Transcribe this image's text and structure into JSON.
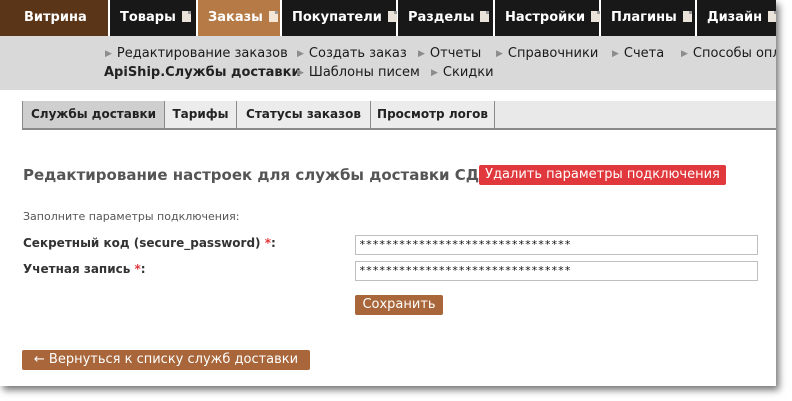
{
  "top_nav": [
    {
      "label": "Витрина"
    },
    {
      "label": "Товары"
    },
    {
      "label": "Заказы"
    },
    {
      "label": "Покупатели"
    },
    {
      "label": "Разделы"
    },
    {
      "label": "Настройки"
    },
    {
      "label": "Плагины"
    },
    {
      "label": "Дизайн"
    }
  ],
  "sub_nav": [
    {
      "label": "Редактирование заказов"
    },
    {
      "label": "Создать заказ"
    },
    {
      "label": "Отчеты"
    },
    {
      "label": "Справочники"
    },
    {
      "label": "Счета"
    },
    {
      "label": "Способы опл"
    },
    {
      "label": "ApiShip.Службы доставки"
    },
    {
      "label": "Шаблоны писем"
    },
    {
      "label": "Скидки"
    }
  ],
  "tabs": [
    {
      "label": "Службы доставки"
    },
    {
      "label": "Тарифы"
    },
    {
      "label": "Статусы заказов"
    },
    {
      "label": "Просмотр логов"
    }
  ],
  "page": {
    "heading": "Редактирование настроек для службы доставки СДЭК",
    "delete_button": "Удалить параметры подключения",
    "hint": "Заполните параметры подключения:",
    "fields": [
      {
        "label": "Секретный код (secure_password)",
        "required_mark": "*",
        "colon": ":",
        "value": "********************************"
      },
      {
        "label": "Учетная запись",
        "required_mark": "*",
        "colon": ":",
        "value": "********************************"
      }
    ],
    "save_button": "Сохранить",
    "back_button": "← Вернуться к списку служб доставки"
  },
  "colors": {
    "accent_brown": "#a8663a",
    "active_tab_brown": "#b57a45",
    "danger_red": "#e0383c",
    "nav_dark": "#181818"
  }
}
